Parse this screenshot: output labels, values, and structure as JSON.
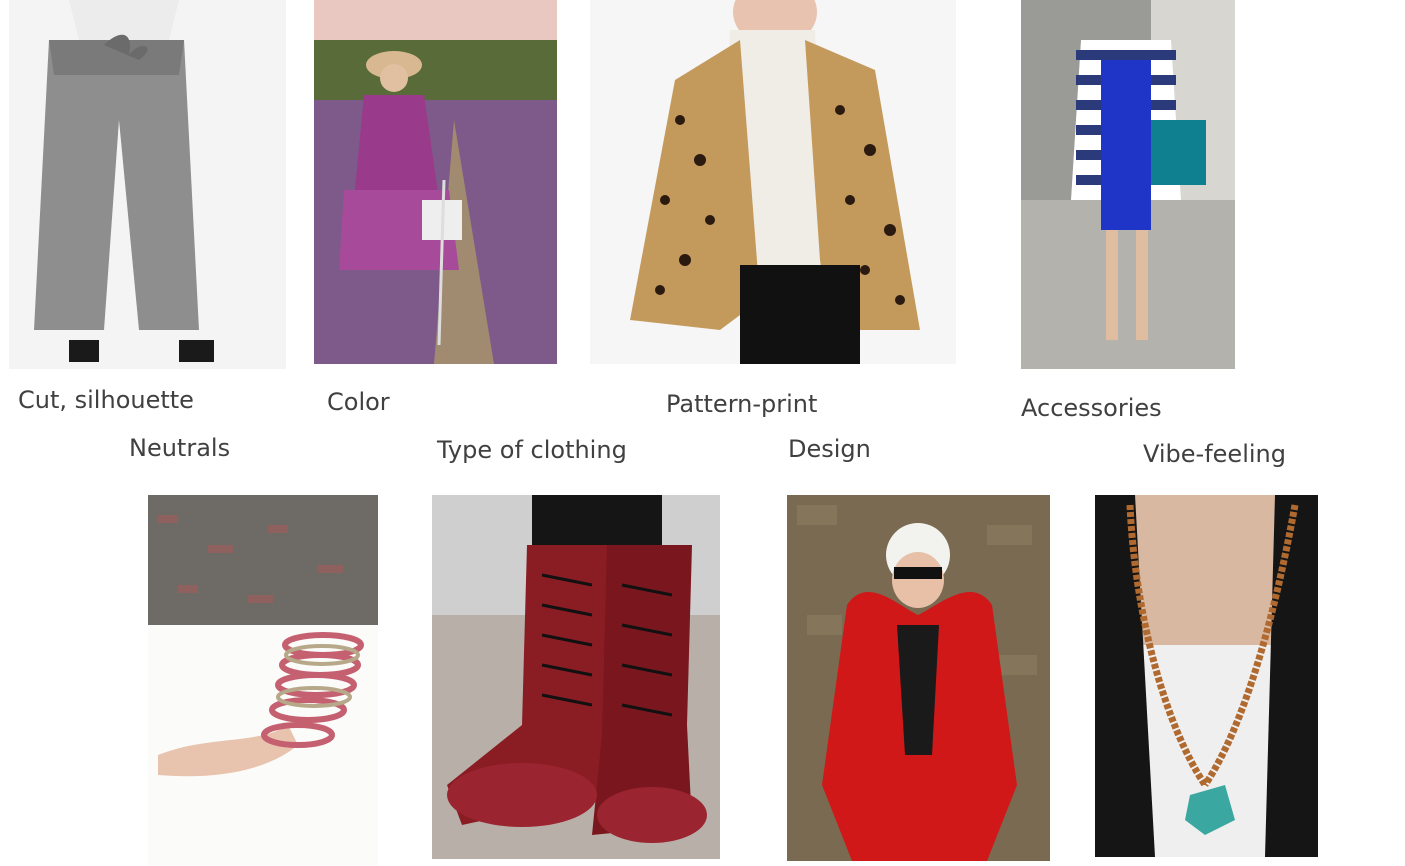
{
  "labels": {
    "cut_silhouette": "Cut, silhouette",
    "color": "Color",
    "pattern_print": "Pattern-print",
    "accessories": "Accessories",
    "neutrals": "Neutrals",
    "type_of_clothing": "Type of clothing",
    "design": "Design",
    "vibe_feeling": "Vibe-feeling"
  },
  "photos": [
    {
      "subject": "grey wide-leg trousers"
    },
    {
      "subject": "woman in purple dress with bicycle in lavender field"
    },
    {
      "subject": "leopard print jacket"
    },
    {
      "subject": "striped coat with blue dress and teal handbag"
    },
    {
      "subject": "stacked bracelets with tweed top"
    },
    {
      "subject": "red lace-up boots"
    },
    {
      "subject": "woman in red sculptural coat"
    },
    {
      "subject": "wooden bead necklace with turquoise pendant"
    }
  ],
  "colors": {
    "label_text": "#404040",
    "background": "#ffffff"
  }
}
